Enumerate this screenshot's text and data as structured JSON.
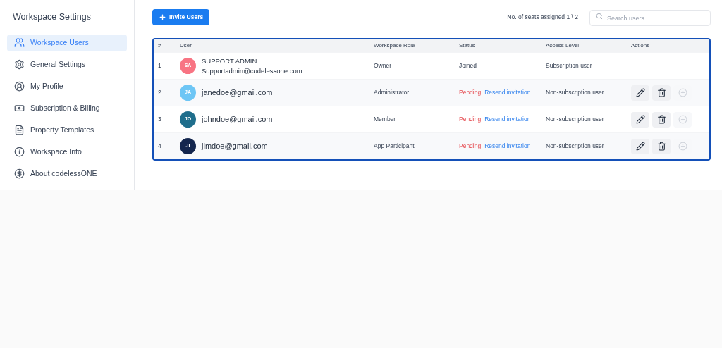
{
  "sidebar": {
    "title": "Workspace Settings",
    "items": [
      {
        "label": "Workspace Users",
        "selected": true
      },
      {
        "label": "General Settings",
        "selected": false
      },
      {
        "label": "My Profile",
        "selected": false
      },
      {
        "label": "Subscription & Billing",
        "selected": false
      },
      {
        "label": "Property Templates",
        "selected": false
      },
      {
        "label": "Workspace Info",
        "selected": false
      },
      {
        "label": "About codelessONE",
        "selected": false
      }
    ]
  },
  "toolbar": {
    "invite_button": "Invite Users",
    "seats": "No. of seats assigned 1 \\ 2",
    "search": {
      "placeholder": "Search users"
    }
  },
  "table": {
    "columns": [
      "#",
      "User",
      "Workspace Role",
      "Status",
      "Access Level",
      "Actions"
    ],
    "rows": [
      {
        "index": "1",
        "initials": "SA",
        "color": "#f87483",
        "name": "SUPPORT ADMIN",
        "email": "Supportadmin@codelessone.com",
        "role": "Owner",
        "status": {
          "kind": "joined",
          "text": "Joined"
        },
        "access": "Subscription user",
        "actions": []
      },
      {
        "index": "2",
        "initials": "JA",
        "color": "#6ec6f5",
        "email": "janedoe@gmail.com",
        "role": "Administrator",
        "status": {
          "kind": "pending",
          "text": "Pending",
          "link": "Resend invitation"
        },
        "access": "Non-subscription user",
        "actions": [
          {
            "kind": "edit",
            "disabled": false
          },
          {
            "kind": "delete",
            "disabled": false
          },
          {
            "kind": "add",
            "disabled": true
          }
        ]
      },
      {
        "index": "3",
        "initials": "JO",
        "color": "#1f6e8c",
        "email": "johndoe@gmail.com",
        "role": "Member",
        "status": {
          "kind": "pending",
          "text": "Pending",
          "link": "Resend invitation"
        },
        "access": "Non-subscription user",
        "actions": [
          {
            "kind": "edit",
            "disabled": false
          },
          {
            "kind": "delete",
            "disabled": false
          },
          {
            "kind": "add",
            "disabled": true
          }
        ]
      },
      {
        "index": "4",
        "initials": "JI",
        "color": "#14264e",
        "email": "jimdoe@gmail.com",
        "role": "App Participant",
        "status": {
          "kind": "pending",
          "text": "Pending",
          "link": "Resend invitation"
        },
        "access": "Non-subscription user",
        "actions": [
          {
            "kind": "edit",
            "disabled": false
          },
          {
            "kind": "delete",
            "disabled": false
          },
          {
            "kind": "add",
            "disabled": true
          }
        ]
      }
    ]
  }
}
